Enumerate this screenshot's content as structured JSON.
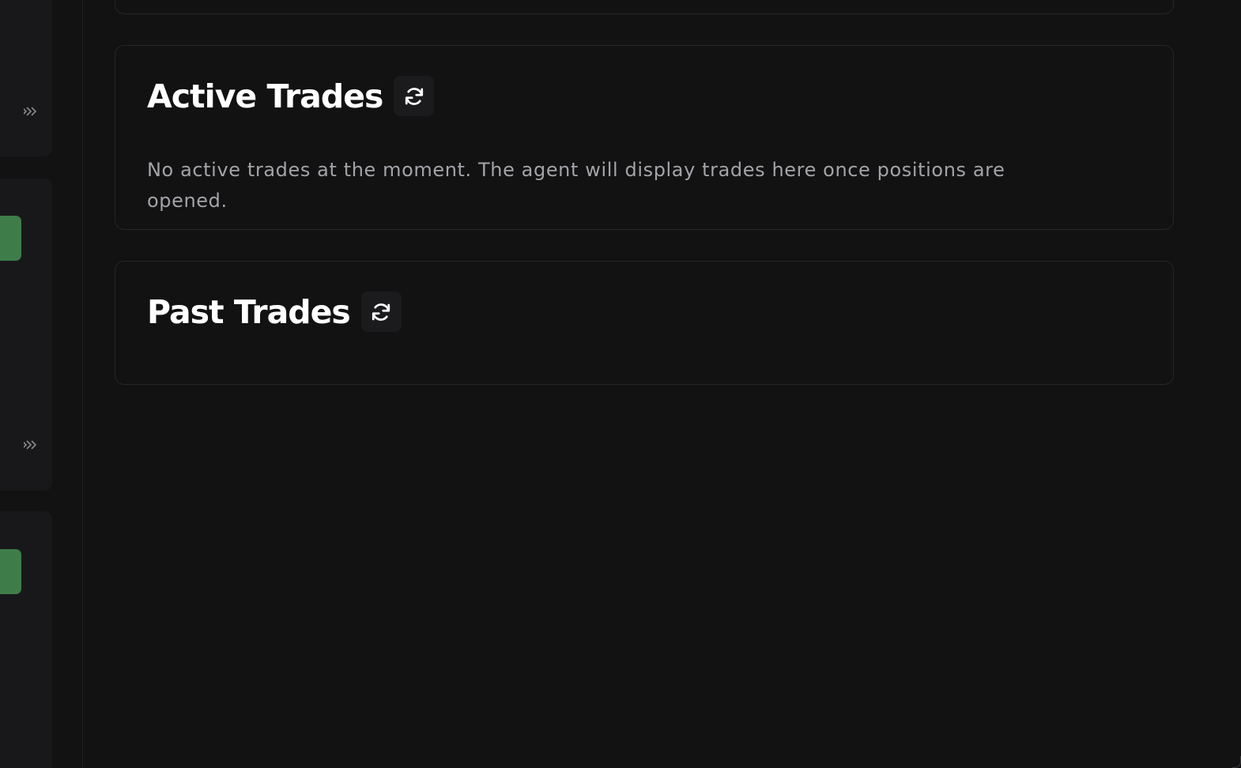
{
  "active_trades": {
    "title": "Active Trades",
    "message": "No active trades at the moment. The agent will display trades here once positions are opened."
  },
  "past_trades": {
    "title": "Past Trades"
  },
  "icons": {
    "refresh": "refresh-icon",
    "expand": "chevrons-right-icon"
  },
  "colors": {
    "background": "#121213",
    "card_border": "#26262a",
    "accent_green": "#3e7d49",
    "title": "#ffffff",
    "muted_text": "#a3a3a8"
  }
}
